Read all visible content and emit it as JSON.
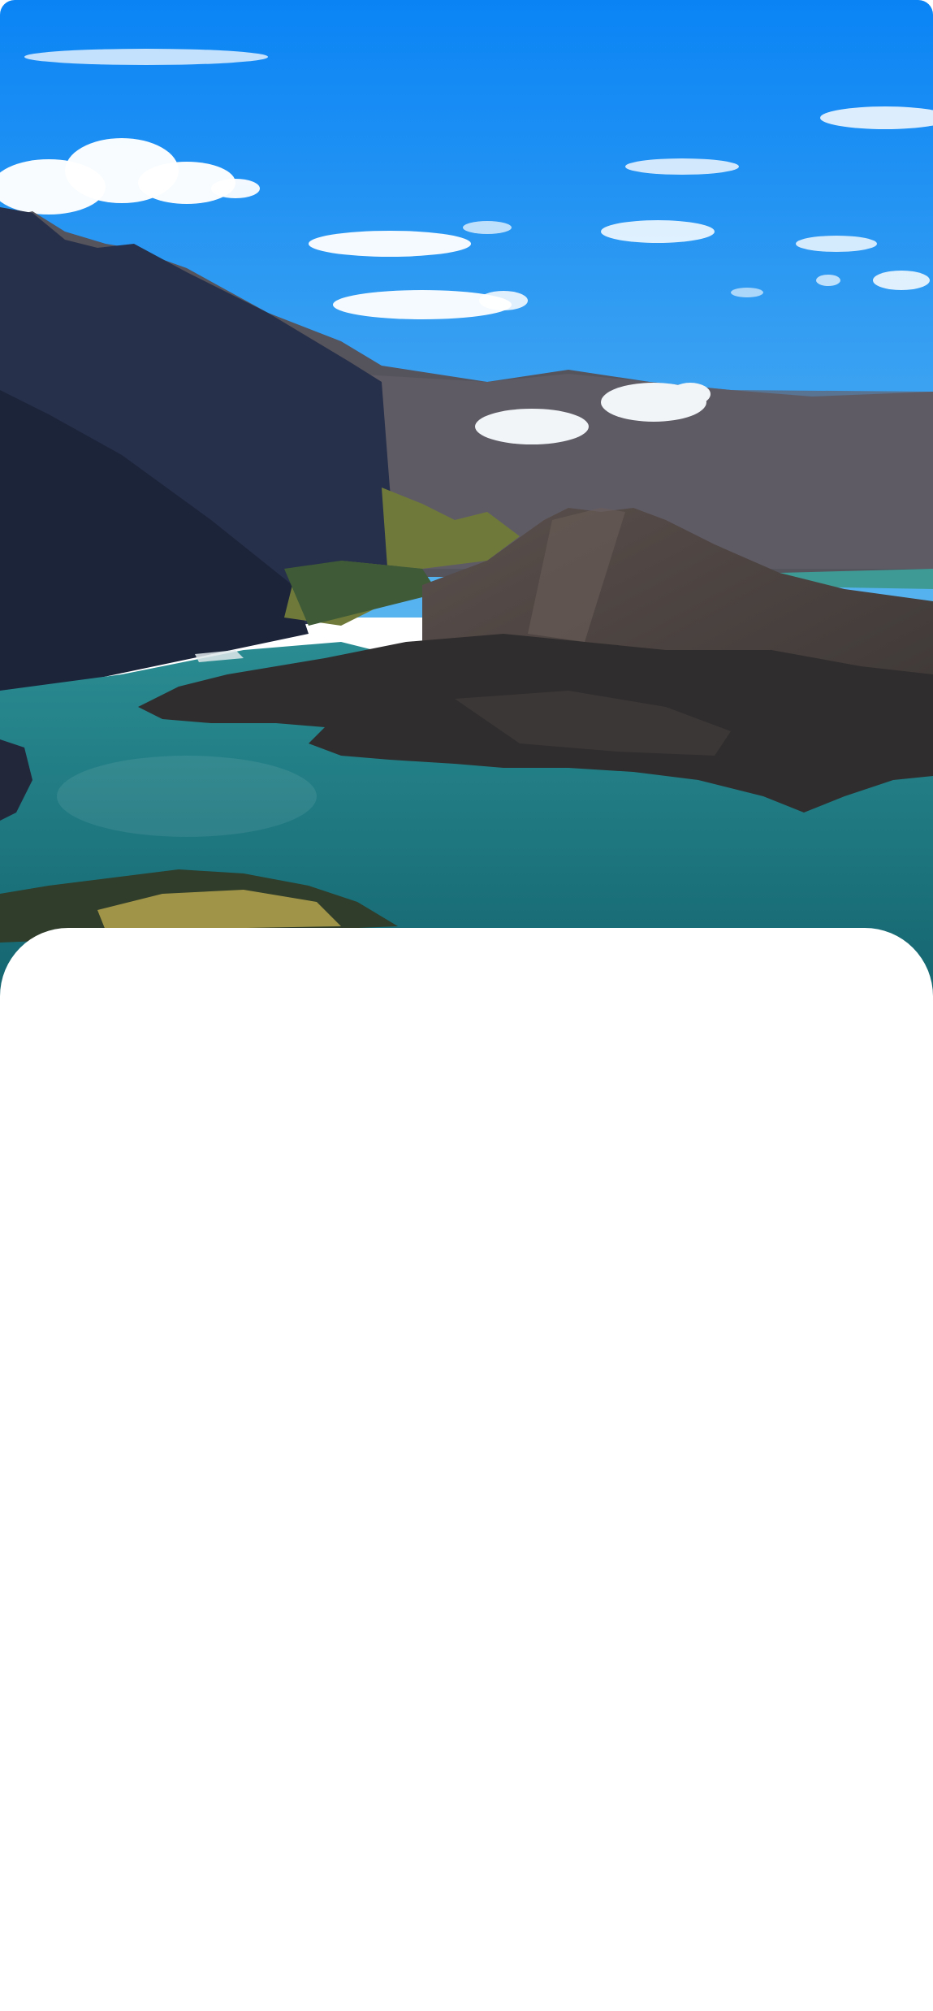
{
  "hero": {
    "image_subject": "volcanic-crater-lake-landscape",
    "colors": {
      "sky_top": "#0a84f5",
      "sky_bottom": "#58b4ef",
      "lake": "#1f7e86",
      "lake_deep": "#14646e",
      "mountain_dark": "#222c44",
      "mountain_mid": "#3a4056",
      "cliff": "#5a5a62",
      "volcano": "#4d4745",
      "lava": "#2f2c2d",
      "grass": "#8a8a3c",
      "foreground_grass": "#a09448",
      "cloud": "#ffffff"
    }
  },
  "sheet": {
    "color": "#ffffff"
  }
}
